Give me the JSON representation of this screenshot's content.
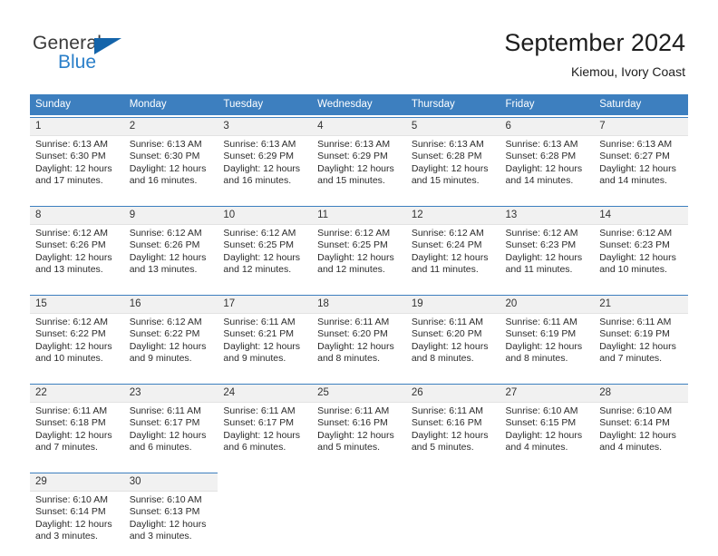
{
  "brand": {
    "name_part1": "General",
    "name_part2": "Blue"
  },
  "header": {
    "title": "September 2024",
    "subtitle": "Kiemou, Ivory Coast"
  },
  "colors": {
    "header_blue": "#3d7fbf",
    "logo_blue": "#2a7fc9",
    "day_number_bg": "#f1f1f1"
  },
  "weekdays": [
    "Sunday",
    "Monday",
    "Tuesday",
    "Wednesday",
    "Thursday",
    "Friday",
    "Saturday"
  ],
  "weeks": [
    [
      {
        "day": "1",
        "sunrise": "Sunrise: 6:13 AM",
        "sunset": "Sunset: 6:30 PM",
        "daylight": "Daylight: 12 hours and 17 minutes."
      },
      {
        "day": "2",
        "sunrise": "Sunrise: 6:13 AM",
        "sunset": "Sunset: 6:30 PM",
        "daylight": "Daylight: 12 hours and 16 minutes."
      },
      {
        "day": "3",
        "sunrise": "Sunrise: 6:13 AM",
        "sunset": "Sunset: 6:29 PM",
        "daylight": "Daylight: 12 hours and 16 minutes."
      },
      {
        "day": "4",
        "sunrise": "Sunrise: 6:13 AM",
        "sunset": "Sunset: 6:29 PM",
        "daylight": "Daylight: 12 hours and 15 minutes."
      },
      {
        "day": "5",
        "sunrise": "Sunrise: 6:13 AM",
        "sunset": "Sunset: 6:28 PM",
        "daylight": "Daylight: 12 hours and 15 minutes."
      },
      {
        "day": "6",
        "sunrise": "Sunrise: 6:13 AM",
        "sunset": "Sunset: 6:28 PM",
        "daylight": "Daylight: 12 hours and 14 minutes."
      },
      {
        "day": "7",
        "sunrise": "Sunrise: 6:13 AM",
        "sunset": "Sunset: 6:27 PM",
        "daylight": "Daylight: 12 hours and 14 minutes."
      }
    ],
    [
      {
        "day": "8",
        "sunrise": "Sunrise: 6:12 AM",
        "sunset": "Sunset: 6:26 PM",
        "daylight": "Daylight: 12 hours and 13 minutes."
      },
      {
        "day": "9",
        "sunrise": "Sunrise: 6:12 AM",
        "sunset": "Sunset: 6:26 PM",
        "daylight": "Daylight: 12 hours and 13 minutes."
      },
      {
        "day": "10",
        "sunrise": "Sunrise: 6:12 AM",
        "sunset": "Sunset: 6:25 PM",
        "daylight": "Daylight: 12 hours and 12 minutes."
      },
      {
        "day": "11",
        "sunrise": "Sunrise: 6:12 AM",
        "sunset": "Sunset: 6:25 PM",
        "daylight": "Daylight: 12 hours and 12 minutes."
      },
      {
        "day": "12",
        "sunrise": "Sunrise: 6:12 AM",
        "sunset": "Sunset: 6:24 PM",
        "daylight": "Daylight: 12 hours and 11 minutes."
      },
      {
        "day": "13",
        "sunrise": "Sunrise: 6:12 AM",
        "sunset": "Sunset: 6:23 PM",
        "daylight": "Daylight: 12 hours and 11 minutes."
      },
      {
        "day": "14",
        "sunrise": "Sunrise: 6:12 AM",
        "sunset": "Sunset: 6:23 PM",
        "daylight": "Daylight: 12 hours and 10 minutes."
      }
    ],
    [
      {
        "day": "15",
        "sunrise": "Sunrise: 6:12 AM",
        "sunset": "Sunset: 6:22 PM",
        "daylight": "Daylight: 12 hours and 10 minutes."
      },
      {
        "day": "16",
        "sunrise": "Sunrise: 6:12 AM",
        "sunset": "Sunset: 6:22 PM",
        "daylight": "Daylight: 12 hours and 9 minutes."
      },
      {
        "day": "17",
        "sunrise": "Sunrise: 6:11 AM",
        "sunset": "Sunset: 6:21 PM",
        "daylight": "Daylight: 12 hours and 9 minutes."
      },
      {
        "day": "18",
        "sunrise": "Sunrise: 6:11 AM",
        "sunset": "Sunset: 6:20 PM",
        "daylight": "Daylight: 12 hours and 8 minutes."
      },
      {
        "day": "19",
        "sunrise": "Sunrise: 6:11 AM",
        "sunset": "Sunset: 6:20 PM",
        "daylight": "Daylight: 12 hours and 8 minutes."
      },
      {
        "day": "20",
        "sunrise": "Sunrise: 6:11 AM",
        "sunset": "Sunset: 6:19 PM",
        "daylight": "Daylight: 12 hours and 8 minutes."
      },
      {
        "day": "21",
        "sunrise": "Sunrise: 6:11 AM",
        "sunset": "Sunset: 6:19 PM",
        "daylight": "Daylight: 12 hours and 7 minutes."
      }
    ],
    [
      {
        "day": "22",
        "sunrise": "Sunrise: 6:11 AM",
        "sunset": "Sunset: 6:18 PM",
        "daylight": "Daylight: 12 hours and 7 minutes."
      },
      {
        "day": "23",
        "sunrise": "Sunrise: 6:11 AM",
        "sunset": "Sunset: 6:17 PM",
        "daylight": "Daylight: 12 hours and 6 minutes."
      },
      {
        "day": "24",
        "sunrise": "Sunrise: 6:11 AM",
        "sunset": "Sunset: 6:17 PM",
        "daylight": "Daylight: 12 hours and 6 minutes."
      },
      {
        "day": "25",
        "sunrise": "Sunrise: 6:11 AM",
        "sunset": "Sunset: 6:16 PM",
        "daylight": "Daylight: 12 hours and 5 minutes."
      },
      {
        "day": "26",
        "sunrise": "Sunrise: 6:11 AM",
        "sunset": "Sunset: 6:16 PM",
        "daylight": "Daylight: 12 hours and 5 minutes."
      },
      {
        "day": "27",
        "sunrise": "Sunrise: 6:10 AM",
        "sunset": "Sunset: 6:15 PM",
        "daylight": "Daylight: 12 hours and 4 minutes."
      },
      {
        "day": "28",
        "sunrise": "Sunrise: 6:10 AM",
        "sunset": "Sunset: 6:14 PM",
        "daylight": "Daylight: 12 hours and 4 minutes."
      }
    ],
    [
      {
        "day": "29",
        "sunrise": "Sunrise: 6:10 AM",
        "sunset": "Sunset: 6:14 PM",
        "daylight": "Daylight: 12 hours and 3 minutes."
      },
      {
        "day": "30",
        "sunrise": "Sunrise: 6:10 AM",
        "sunset": "Sunset: 6:13 PM",
        "daylight": "Daylight: 12 hours and 3 minutes."
      },
      null,
      null,
      null,
      null,
      null
    ]
  ]
}
